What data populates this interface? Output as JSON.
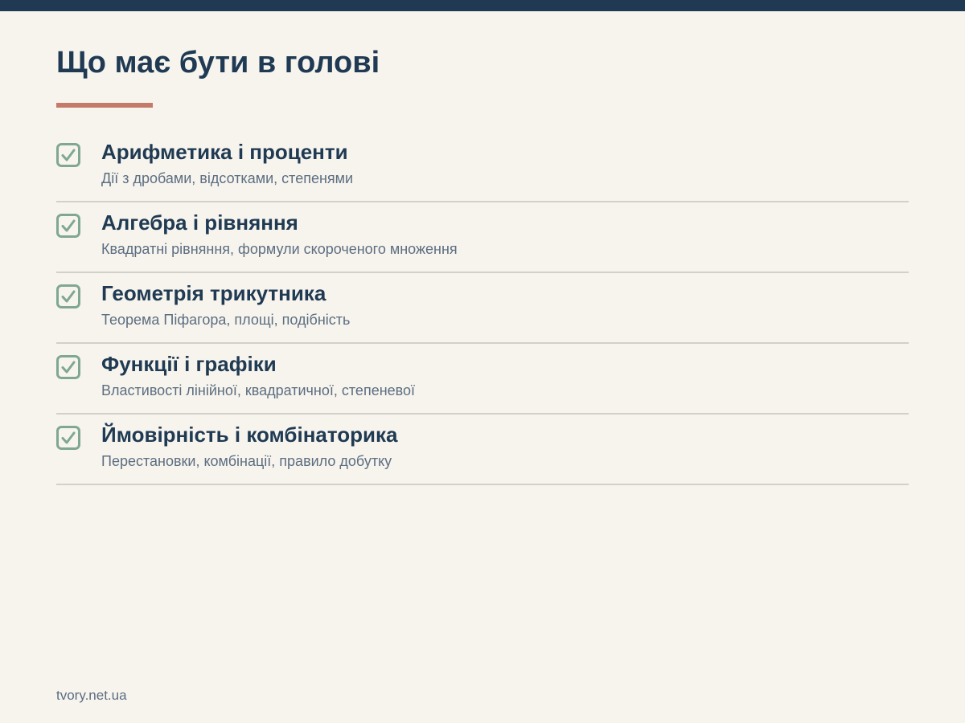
{
  "page": {
    "title": "Що має бути в голові",
    "footer": "tvory.net.ua"
  },
  "colors": {
    "background": "#f7f4ee",
    "top_bar": "#1f3a52",
    "title": "#1f3a52",
    "accent": "#c47c6a",
    "check": "#7fa791",
    "description": "#5c6e80",
    "divider": "#d3d0c9"
  },
  "checklist": {
    "items": [
      {
        "icon": "checkbox-checked-icon",
        "title": "Арифметика і проценти",
        "description": "Дії з дробами, відсотками, степенями"
      },
      {
        "icon": "checkbox-checked-icon",
        "title": "Алгебра і рівняння",
        "description": "Квадратні рівняння, формули скороченого множення"
      },
      {
        "icon": "checkbox-checked-icon",
        "title": "Геометрія трикутника",
        "description": "Теорема Піфагора, площі, подібність"
      },
      {
        "icon": "checkbox-checked-icon",
        "title": "Функції і графіки",
        "description": "Властивості лінійної, квадратичної, степеневої"
      },
      {
        "icon": "checkbox-checked-icon",
        "title": "Ймовірність і комбінаторика",
        "description": "Перестановки, комбінації, правило добутку"
      }
    ]
  }
}
